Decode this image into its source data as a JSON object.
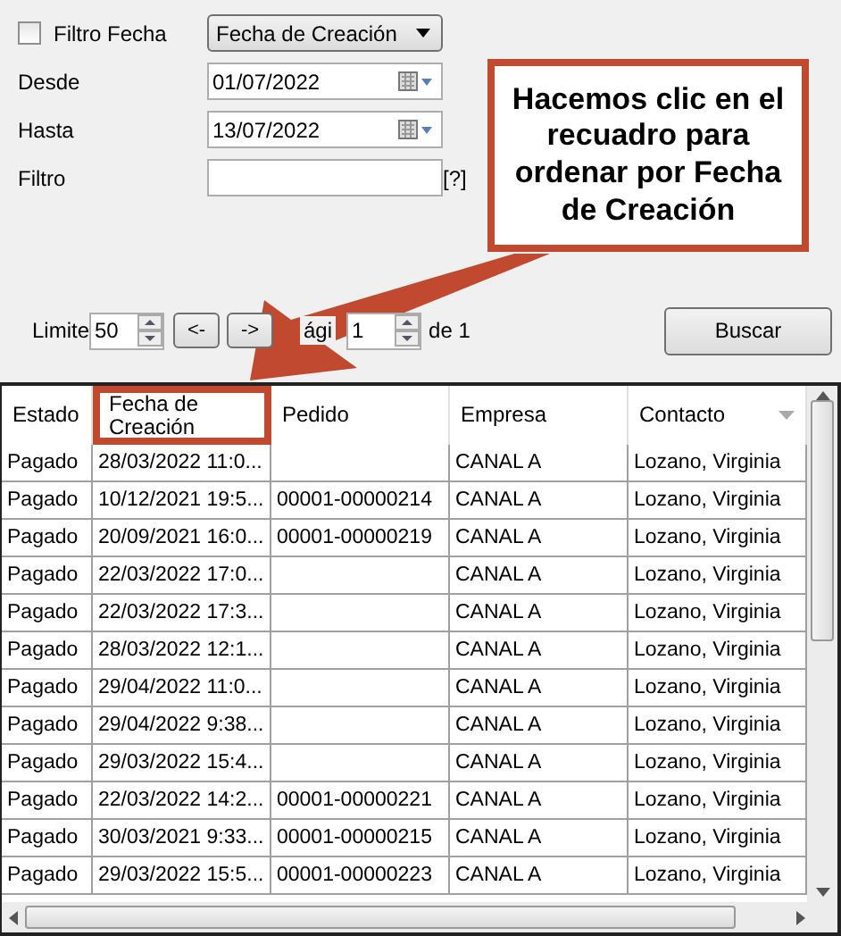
{
  "filter": {
    "date_filter_label": "Filtro Fecha",
    "date_filter_checked": false,
    "date_field": "Fecha de Creación",
    "from_label": "Desde",
    "from_value": "01/07/2022",
    "to_label": "Hasta",
    "to_value": "13/07/2022",
    "text_label": "Filtro",
    "help": "[?]"
  },
  "pager": {
    "limit_label": "Limite",
    "limit_value": "50",
    "prev": "<-",
    "next": "->",
    "page_label": "ági",
    "page_value": "1",
    "page_total": "de 1",
    "search_button": "Buscar"
  },
  "callout": "Hacemos clic en el recuadro para ordenar por Fecha de Creación",
  "table": {
    "columns": [
      {
        "label": "Estado",
        "highlighted": false
      },
      {
        "label": "Fecha de Creación",
        "highlighted": true
      },
      {
        "label": "Pedido",
        "highlighted": false
      },
      {
        "label": "Empresa",
        "highlighted": false
      },
      {
        "label": "Contacto",
        "highlighted": false
      }
    ],
    "rows": [
      [
        "Pagado",
        "28/03/2022 11:0...",
        "",
        "CANAL A",
        "Lozano, Virginia"
      ],
      [
        "Pagado",
        "10/12/2021 19:5...",
        "00001-00000214",
        "CANAL A",
        "Lozano, Virginia"
      ],
      [
        "Pagado",
        "20/09/2021 16:0...",
        "00001-00000219",
        "CANAL A",
        "Lozano, Virginia"
      ],
      [
        "Pagado",
        "22/03/2022 17:0...",
        "",
        "CANAL A",
        "Lozano, Virginia"
      ],
      [
        "Pagado",
        "22/03/2022 17:3...",
        "",
        "CANAL A",
        "Lozano, Virginia"
      ],
      [
        "Pagado",
        "28/03/2022 12:1...",
        "",
        "CANAL A",
        "Lozano, Virginia"
      ],
      [
        "Pagado",
        "29/04/2022 11:0...",
        "",
        "CANAL A",
        "Lozano, Virginia"
      ],
      [
        "Pagado",
        "29/04/2022 9:38...",
        "",
        "CANAL A",
        "Lozano, Virginia"
      ],
      [
        "Pagado",
        "29/03/2022 15:4...",
        "",
        "CANAL A",
        "Lozano, Virginia"
      ],
      [
        "Pagado",
        "22/03/2022 14:2...",
        "00001-00000221",
        "CANAL A",
        "Lozano, Virginia"
      ],
      [
        "Pagado",
        "30/03/2021 9:33...",
        "00001-00000215",
        "CANAL A",
        "Lozano, Virginia"
      ],
      [
        "Pagado",
        "29/03/2022 15:5...",
        "00001-00000223",
        "CANAL A",
        "Lozano, Virginia"
      ]
    ]
  }
}
